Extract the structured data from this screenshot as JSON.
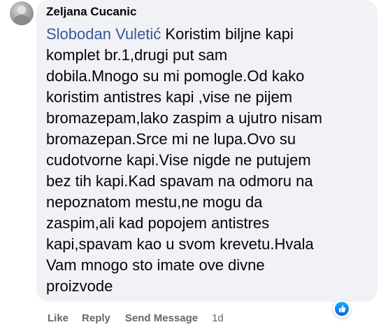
{
  "comment": {
    "author": "Zeljana Cucanic",
    "mention": "Slobodan Vuletić",
    "text_lines": [
      " Koristim biljne kapi",
      "komplet br.1,drugi put sam",
      "dobila.Mnogo su mi pomogle.Od kako",
      "koristim antistres kapi ,vise ne pijem",
      "bromazepam,lako zaspim a ujutro nisam",
      "bromazepan.Srce mi ne lupa.Ovo su",
      "cudotvorne kapi.Vise nigde ne putujem",
      "bez tih kapi.Kad spavam na odmoru na",
      "nepoznatom mestu,ne mogu da",
      "zaspim,ali kad popojem antistres",
      "kapi,spavam kao u svom krevetu.Hvala",
      "Vam mnogo sto imate ove divne",
      "proizvode"
    ],
    "reaction_icon": "like-reaction-icon"
  },
  "actions": {
    "like": "Like",
    "reply": "Reply",
    "send_message": "Send Message",
    "time": "1d"
  },
  "colors": {
    "bubble_bg": "#f0f2f5",
    "mention": "#385898",
    "action_text": "#65676b",
    "like_blue": "#0866ff"
  }
}
